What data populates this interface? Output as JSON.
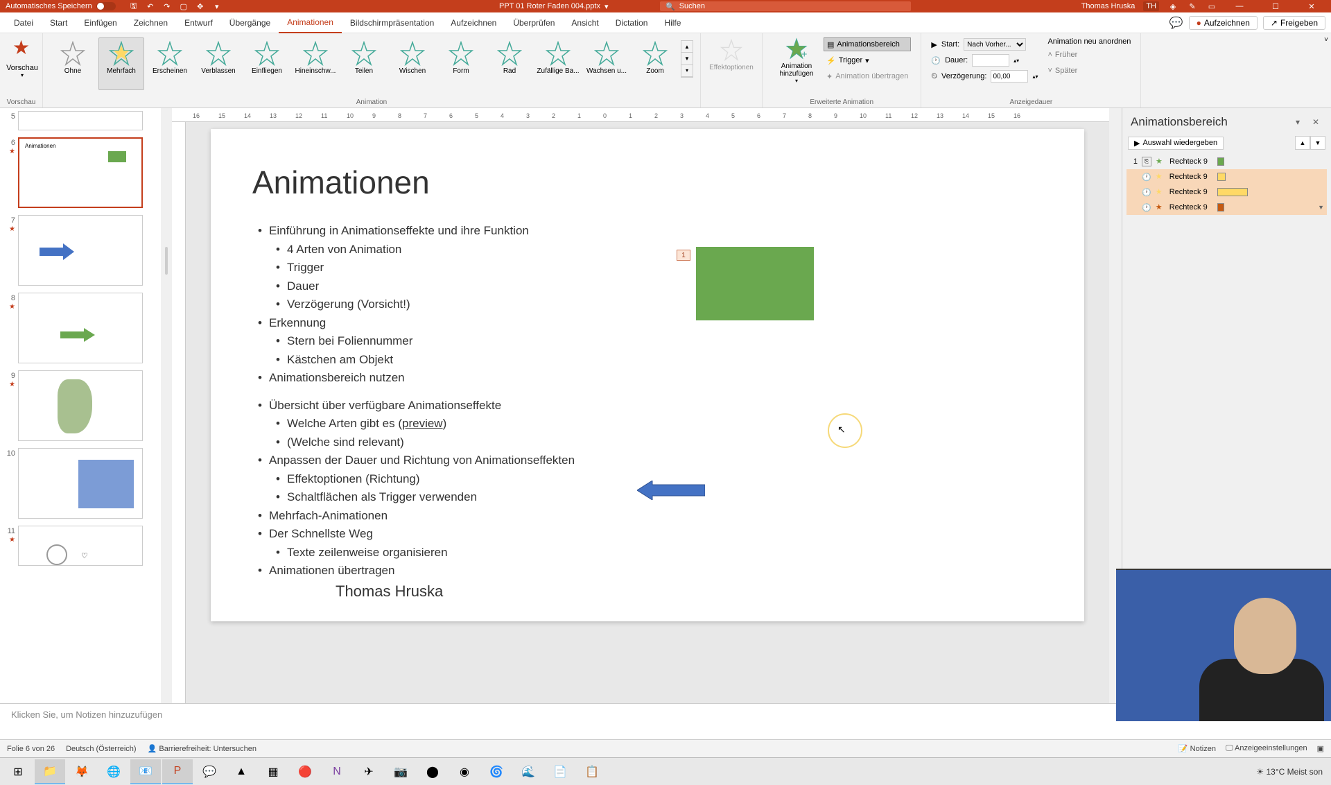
{
  "titlebar": {
    "autosave": "Automatisches Speichern",
    "filename": "PPT 01 Roter Faden 004.pptx",
    "search_placeholder": "Suchen",
    "user": "Thomas Hruska",
    "user_initials": "TH"
  },
  "tabs": {
    "datei": "Datei",
    "start": "Start",
    "einfuegen": "Einfügen",
    "zeichnen": "Zeichnen",
    "entwurf": "Entwurf",
    "uebergaenge": "Übergänge",
    "animationen": "Animationen",
    "bildschirm": "Bildschirmpräsentation",
    "aufzeichnen_tab": "Aufzeichnen",
    "ueberpruefen": "Überprüfen",
    "ansicht": "Ansicht",
    "dictation": "Dictation",
    "hilfe": "Hilfe",
    "aufzeichnen": "Aufzeichnen",
    "freigeben": "Freigeben"
  },
  "ribbon": {
    "vorschau": "Vorschau",
    "vorschau_grp": "Vorschau",
    "anims": {
      "ohne": "Ohne",
      "mehrfach": "Mehrfach",
      "erscheinen": "Erscheinen",
      "verblassen": "Verblassen",
      "einfliegen": "Einfliegen",
      "hineinschweben": "Hineinschw...",
      "teilen": "Teilen",
      "wischen": "Wischen",
      "form": "Form",
      "rad": "Rad",
      "zufaellig": "Zufällige Ba...",
      "wachsen": "Wachsen u...",
      "zoom": "Zoom"
    },
    "animation_grp": "Animation",
    "effektoptionen": "Effektoptionen",
    "add_anim": "Animation hinzufügen",
    "anim_bereich": "Animationsbereich",
    "trigger": "Trigger",
    "anim_uebertragen": "Animation übertragen",
    "erweiterte_grp": "Erweiterte Animation",
    "start_lbl": "Start:",
    "start_val": "Nach Vorher...",
    "dauer_lbl": "Dauer:",
    "dauer_val": "",
    "verzoegerung_lbl": "Verzögerung:",
    "verzoegerung_val": "00,00",
    "reorder": "Animation neu anordnen",
    "frueher": "Früher",
    "spaeter": "Später",
    "anzeigedauer_grp": "Anzeigedauer"
  },
  "thumbs": [
    {
      "n": "5"
    },
    {
      "n": "6"
    },
    {
      "n": "7"
    },
    {
      "n": "8"
    },
    {
      "n": "9"
    },
    {
      "n": "10"
    },
    {
      "n": "11"
    }
  ],
  "slide": {
    "title": "Animationen",
    "b1": "Einführung in Animationseffekte und ihre Funktion",
    "b1a": "4 Arten von Animation",
    "b1b": "Trigger",
    "b1c": "Dauer",
    "b1d": "Verzögerung (Vorsicht!)",
    "b2": "Erkennung",
    "b2a": "Stern bei Foliennummer",
    "b2b": "Kästchen am Objekt",
    "b3": "Animationsbereich nutzen",
    "b4": "Übersicht über verfügbare Animationseffekte",
    "b4a_pre": "Welche Arten gibt es (",
    "b4a_link": "preview",
    "b4a_post": ")",
    "b4b": "(Welche sind relevant)",
    "b5": "Anpassen der Dauer und Richtung von Animationseffekten",
    "b5a": "Effektoptionen (Richtung)",
    "b5b": "Schaltflächen als Trigger verwenden",
    "b6": "Mehrfach-Animationen",
    "b7": "Der Schnellste Weg",
    "b7a": "Texte zeilenweise organisieren",
    "b8": "Animationen übertragen",
    "author": "Thomas Hruska",
    "tag": "1"
  },
  "anim_pane": {
    "title": "Animationsbereich",
    "play": "Auswahl wiedergeben",
    "items": [
      {
        "n": "1",
        "name": "Rechteck 9",
        "color": "#6aa84f",
        "w": 10,
        "sel": false,
        "trig": "box"
      },
      {
        "n": "",
        "name": "Rechteck 9",
        "color": "#ffd966",
        "w": 12,
        "sel": true,
        "trig": "clock"
      },
      {
        "n": "",
        "name": "Rechteck 9",
        "color": "#ffd966",
        "w": 44,
        "sel": true,
        "trig": "clock"
      },
      {
        "n": "",
        "name": "Rechteck 9",
        "color": "#c55a11",
        "w": 10,
        "sel": true,
        "trig": "clock"
      }
    ]
  },
  "notes": {
    "placeholder": "Klicken Sie, um Notizen hinzuzufügen"
  },
  "status": {
    "slide": "Folie 6 von 26",
    "lang": "Deutsch (Österreich)",
    "access": "Barrierefreiheit: Untersuchen",
    "notizen": "Notizen",
    "anzeige": "Anzeigeeinstellungen"
  },
  "taskbar": {
    "weather": "13°C  Meist son"
  },
  "hruler": [
    "16",
    "15",
    "14",
    "13",
    "12",
    "11",
    "10",
    "9",
    "8",
    "7",
    "6",
    "5",
    "4",
    "3",
    "2",
    "1",
    "0",
    "1",
    "2",
    "3",
    "4",
    "5",
    "6",
    "7",
    "8",
    "9",
    "10",
    "11",
    "12",
    "13",
    "14",
    "15",
    "16"
  ],
  "colors": {
    "accent": "#c43e1c",
    "green": "#6aa84f",
    "blue": "#4472c4"
  }
}
